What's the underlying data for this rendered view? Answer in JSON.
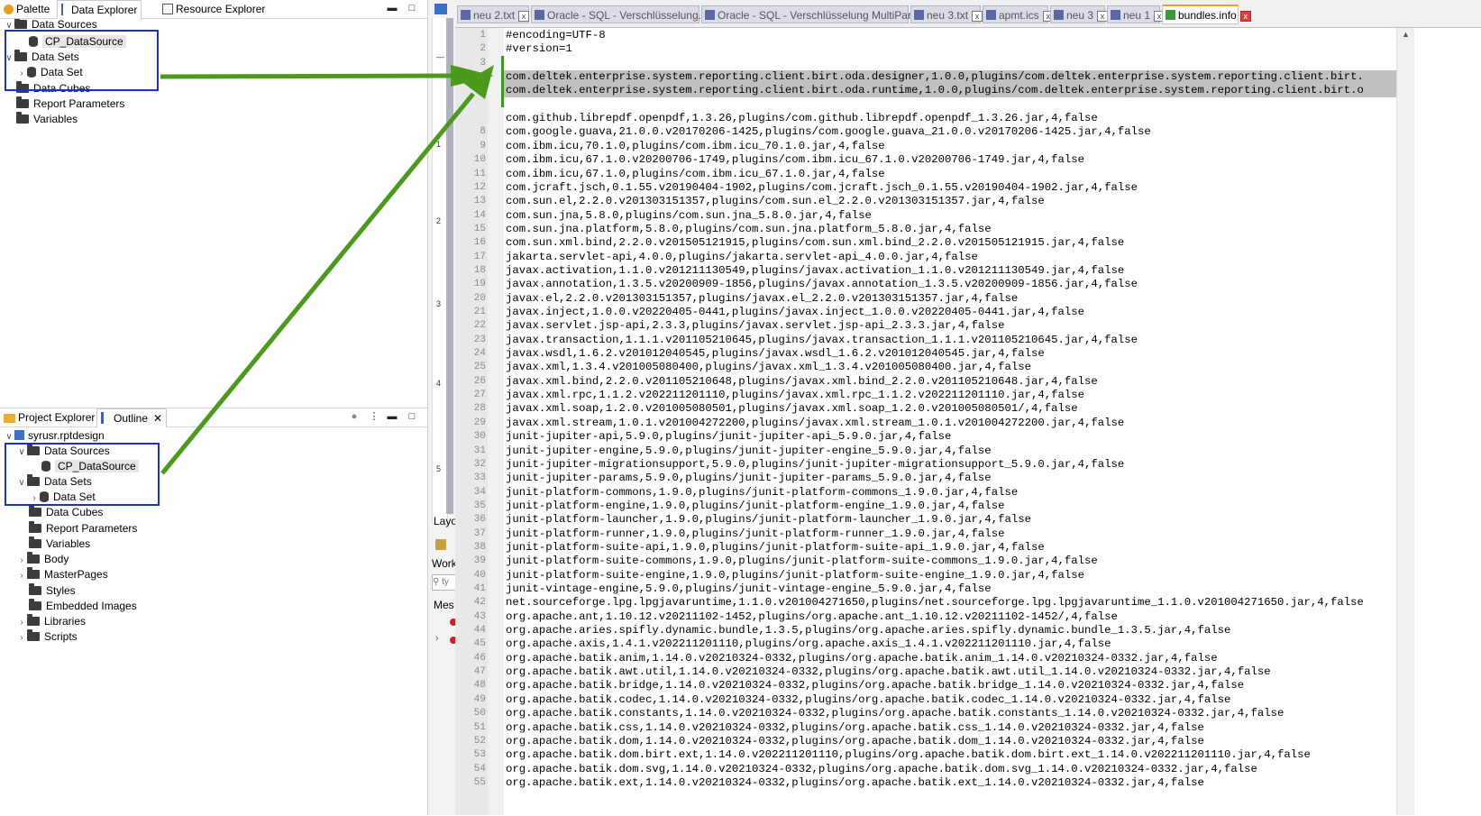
{
  "top_panel": {
    "tabs": [
      {
        "label": "Palette"
      },
      {
        "label": "Data Explorer"
      },
      {
        "label": "Resource Explorer"
      }
    ],
    "tree": [
      {
        "label": "Data Sources"
      },
      {
        "label": "CP_DataSource"
      },
      {
        "label": "Data Sets"
      },
      {
        "label": "Data Set"
      },
      {
        "label": "Data Cubes"
      },
      {
        "label": "Report Parameters"
      },
      {
        "label": "Variables"
      }
    ]
  },
  "bottom_panel": {
    "tabs": [
      {
        "label": "Project Explorer"
      },
      {
        "label": "Outline"
      }
    ],
    "tree": [
      {
        "label": "syrusr.rptdesign"
      },
      {
        "label": "Data Sources"
      },
      {
        "label": "CP_DataSource"
      },
      {
        "label": "Data Sets"
      },
      {
        "label": "Data Set"
      },
      {
        "label": "Data Cubes"
      },
      {
        "label": "Report Parameters"
      },
      {
        "label": "Variables"
      },
      {
        "label": "Body"
      },
      {
        "label": "MasterPages"
      },
      {
        "label": "Styles"
      },
      {
        "label": "Embedded Images"
      },
      {
        "label": "Libraries"
      },
      {
        "label": "Scripts"
      }
    ]
  },
  "middle_strip": {
    "labels": [
      "Layo",
      "Work",
      "Mes"
    ]
  },
  "editor": {
    "tabs": [
      {
        "label": "neu 2.txt"
      },
      {
        "label": "Oracle - SQL - Verschlüsselung.txt"
      },
      {
        "label": "Oracle - SQL - Verschlüsselung MultiPart.txt"
      },
      {
        "label": "neu 3.txt"
      },
      {
        "label": "apmt.ics"
      },
      {
        "label": "neu 3"
      },
      {
        "label": "neu 1"
      },
      {
        "label": "bundles.info"
      }
    ],
    "lines": [
      "#encoding=UTF-8",
      "#version=1",
      "",
      "com.deltek.enterprise.system.reporting.client.birt.oda.designer,1.0.0,plugins/com.deltek.enterprise.system.reporting.client.birt.",
      "com.deltek.enterprise.system.reporting.client.birt.oda.runtime,1.0.0,plugins/com.deltek.enterprise.system.reporting.client.birt.o",
      "",
      "com.github.librepdf.openpdf,1.3.26,plugins/com.github.librepdf.openpdf_1.3.26.jar,4,false",
      "com.google.guava,21.0.0.v20170206-1425,plugins/com.google.guava_21.0.0.v20170206-1425.jar,4,false",
      "com.ibm.icu,70.1.0,plugins/com.ibm.icu_70.1.0.jar,4,false",
      "com.ibm.icu,67.1.0.v20200706-1749,plugins/com.ibm.icu_67.1.0.v20200706-1749.jar,4,false",
      "com.ibm.icu,67.1.0,plugins/com.ibm.icu_67.1.0.jar,4,false",
      "com.jcraft.jsch,0.1.55.v20190404-1902,plugins/com.jcraft.jsch_0.1.55.v20190404-1902.jar,4,false",
      "com.sun.el,2.2.0.v201303151357,plugins/com.sun.el_2.2.0.v201303151357.jar,4,false",
      "com.sun.jna,5.8.0,plugins/com.sun.jna_5.8.0.jar,4,false",
      "com.sun.jna.platform,5.8.0,plugins/com.sun.jna.platform_5.8.0.jar,4,false",
      "com.sun.xml.bind,2.2.0.v201505121915,plugins/com.sun.xml.bind_2.2.0.v201505121915.jar,4,false",
      "jakarta.servlet-api,4.0.0,plugins/jakarta.servlet-api_4.0.0.jar,4,false",
      "javax.activation,1.1.0.v201211130549,plugins/javax.activation_1.1.0.v201211130549.jar,4,false",
      "javax.annotation,1.3.5.v20200909-1856,plugins/javax.annotation_1.3.5.v20200909-1856.jar,4,false",
      "javax.el,2.2.0.v201303151357,plugins/javax.el_2.2.0.v201303151357.jar,4,false",
      "javax.inject,1.0.0.v20220405-0441,plugins/javax.inject_1.0.0.v20220405-0441.jar,4,false",
      "javax.servlet.jsp-api,2.3.3,plugins/javax.servlet.jsp-api_2.3.3.jar,4,false",
      "javax.transaction,1.1.1.v201105210645,plugins/javax.transaction_1.1.1.v201105210645.jar,4,false",
      "javax.wsdl,1.6.2.v201012040545,plugins/javax.wsdl_1.6.2.v201012040545.jar,4,false",
      "javax.xml,1.3.4.v201005080400,plugins/javax.xml_1.3.4.v201005080400.jar,4,false",
      "javax.xml.bind,2.2.0.v201105210648,plugins/javax.xml.bind_2.2.0.v201105210648.jar,4,false",
      "javax.xml.rpc,1.1.2.v202211201110,plugins/javax.xml.rpc_1.1.2.v202211201110.jar,4,false",
      "javax.xml.soap,1.2.0.v201005080501,plugins/javax.xml.soap_1.2.0.v201005080501/,4,false",
      "javax.xml.stream,1.0.1.v201004272200,plugins/javax.xml.stream_1.0.1.v201004272200.jar,4,false",
      "junit-jupiter-api,5.9.0,plugins/junit-jupiter-api_5.9.0.jar,4,false",
      "junit-jupiter-engine,5.9.0,plugins/junit-jupiter-engine_5.9.0.jar,4,false",
      "junit-jupiter-migrationsupport,5.9.0,plugins/junit-jupiter-migrationsupport_5.9.0.jar,4,false",
      "junit-jupiter-params,5.9.0,plugins/junit-jupiter-params_5.9.0.jar,4,false",
      "junit-platform-commons,1.9.0,plugins/junit-platform-commons_1.9.0.jar,4,false",
      "junit-platform-engine,1.9.0,plugins/junit-platform-engine_1.9.0.jar,4,false",
      "junit-platform-launcher,1.9.0,plugins/junit-platform-launcher_1.9.0.jar,4,false",
      "junit-platform-runner,1.9.0,plugins/junit-platform-runner_1.9.0.jar,4,false",
      "junit-platform-suite-api,1.9.0,plugins/junit-platform-suite-api_1.9.0.jar,4,false",
      "junit-platform-suite-commons,1.9.0,plugins/junit-platform-suite-commons_1.9.0.jar,4,false",
      "junit-platform-suite-engine,1.9.0,plugins/junit-platform-suite-engine_1.9.0.jar,4,false",
      "junit-vintage-engine,5.9.0,plugins/junit-vintage-engine_5.9.0.jar,4,false",
      "net.sourceforge.lpg.lpgjavaruntime,1.1.0.v201004271650,plugins/net.sourceforge.lpg.lpgjavaruntime_1.1.0.v201004271650.jar,4,false",
      "org.apache.ant,1.10.12.v20211102-1452,plugins/org.apache.ant_1.10.12.v20211102-1452/,4,false",
      "org.apache.aries.spifly.dynamic.bundle,1.3.5,plugins/org.apache.aries.spifly.dynamic.bundle_1.3.5.jar,4,false",
      "org.apache.axis,1.4.1.v202211201110,plugins/org.apache.axis_1.4.1.v202211201110.jar,4,false",
      "org.apache.batik.anim,1.14.0.v20210324-0332,plugins/org.apache.batik.anim_1.14.0.v20210324-0332.jar,4,false",
      "org.apache.batik.awt.util,1.14.0.v20210324-0332,plugins/org.apache.batik.awt.util_1.14.0.v20210324-0332.jar,4,false",
      "org.apache.batik.bridge,1.14.0.v20210324-0332,plugins/org.apache.batik.bridge_1.14.0.v20210324-0332.jar,4,false",
      "org.apache.batik.codec,1.14.0.v20210324-0332,plugins/org.apache.batik.codec_1.14.0.v20210324-0332.jar,4,false",
      "org.apache.batik.constants,1.14.0.v20210324-0332,plugins/org.apache.batik.constants_1.14.0.v20210324-0332.jar,4,false",
      "org.apache.batik.css,1.14.0.v20210324-0332,plugins/org.apache.batik.css_1.14.0.v20210324-0332.jar,4,false",
      "org.apache.batik.dom,1.14.0.v20210324-0332,plugins/org.apache.batik.dom_1.14.0.v20210324-0332.jar,4,false",
      "org.apache.batik.dom.birt.ext,1.14.0.v202211201110,plugins/org.apache.batik.dom.birt.ext_1.14.0.v202211201110.jar,4,false",
      "org.apache.batik.dom.svg,1.14.0.v20210324-0332,plugins/org.apache.batik.dom.svg_1.14.0.v20210324-0332.jar,4,false",
      "org.apache.batik.ext,1.14.0.v20210324-0332,plugins/org.apache.batik.ext_1.14.0.v20210324-0332.jar,4,false"
    ],
    "highlighted_line_numbers": [
      4,
      5
    ],
    "visible_line_numbers": [
      "1",
      "2",
      "3",
      "4",
      "5",
      "",
      "",
      "8",
      "9",
      "10",
      "11",
      "12",
      "13",
      "14",
      "15",
      "16",
      "17",
      "18",
      "19",
      "20",
      "21",
      "22",
      "23",
      "24",
      "25",
      "26",
      "27",
      "28",
      "29",
      "30",
      "31",
      "32",
      "33",
      "34",
      "35",
      "36",
      "37",
      "38",
      "39",
      "40",
      "41",
      "42",
      "43",
      "44",
      "45",
      "46",
      "47",
      "48",
      "49",
      "50",
      "51",
      "52",
      "53",
      "54",
      "55"
    ]
  },
  "colors": {
    "annotation_arrow": "#4c9a1c",
    "annotation_box": "#1a2fd6",
    "highlight": "#c0c0c0"
  }
}
